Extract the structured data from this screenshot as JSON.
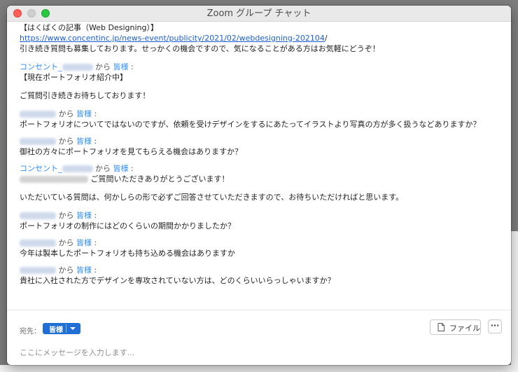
{
  "window": {
    "title": "Zoom グループ チャット"
  },
  "messages": {
    "intro_line1": "【はくばくの記事（Web Designing）】",
    "intro_link": "https://www.concentinc.jp/news-event/publicity/2021/02/webdesigning-202104",
    "intro_link_suffix": "/",
    "intro_line3": "引き続き質問も募集しております。せっかくの機会ですので、気になることがある方はお気軽にどうぞ！",
    "m1_sender": "コンセント_",
    "m1_from": "から",
    "m1_to": "皆様",
    "m1_colon": ":",
    "m1_body1": "【現在ポートフォリオ紹介中】",
    "m1_body2": "ご質問引き続きお待ちしております！",
    "m2_from": "から",
    "m2_to": "皆様",
    "m2_colon": ":",
    "m2_body": "ポートフォリオについてではないのですが、依頼を受けデザインをするにあたってイラストより写真の方が多く扱うなどありますか？",
    "m3_from": "から",
    "m3_to": "皆様",
    "m3_colon": ":",
    "m3_body": "御社の方々にポートフォリオを見てもらえる機会はありますか？",
    "m4_sender": "コンセント_",
    "m4_from": "から",
    "m4_to": "皆様",
    "m4_colon": ":",
    "m4_body1": "ご質問いただきありがとうございます！",
    "m4_body2": "いただいている質問は、何かしらの形で必ずご回答させていただきますので、お待ちいただければと思います。",
    "m5_from": "から",
    "m5_to": "皆様",
    "m5_colon": ":",
    "m5_body": "ポートフォリオの制作にはどのくらいの期間かかりましたか？",
    "m6_from": "から",
    "m6_to": "皆様",
    "m6_colon": ":",
    "m6_body": "今年は製本したポートフォリオも持ち込める機会はありますか",
    "m7_from": "から",
    "m7_to": "皆様",
    "m7_colon": ":",
    "m7_body": "貴社に入社された方でデザインを専攻されていない方は、どのくらいいらっしゃいますか？"
  },
  "compose": {
    "to_label": "宛先：",
    "to_value": "皆様",
    "file_button": "ファイル",
    "more_button": "···",
    "input_placeholder": "ここにメッセージを入力します..."
  },
  "colors": {
    "accent": "#2d8cff",
    "to_button": "#1f6fd6",
    "link": "#1a5fd6"
  }
}
